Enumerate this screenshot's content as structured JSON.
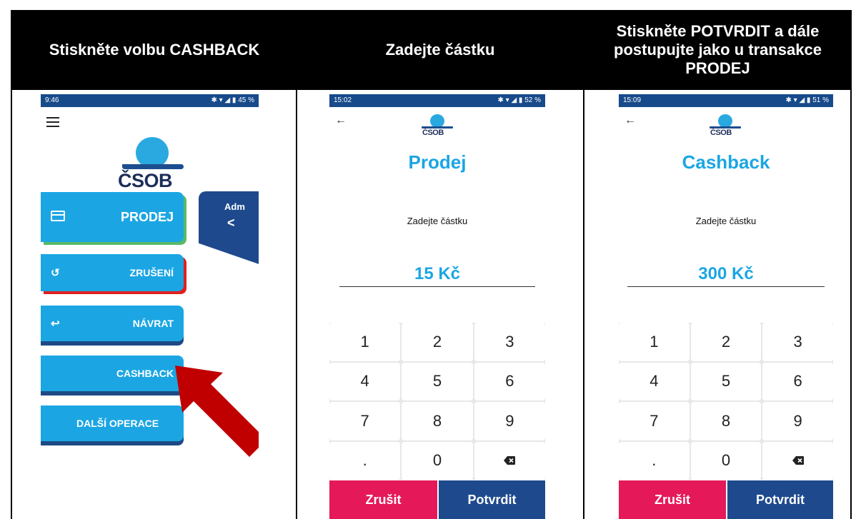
{
  "headers": {
    "col1": "Stiskněte volbu CASHBACK",
    "col2": "Zadejte částku",
    "col3": "Stiskněte POTVRDIT a dále postupujte jako u transakce PRODEJ"
  },
  "phone1": {
    "status_time": "9:46",
    "status_icons": "✱ ▾ ◢ ▮ 45 %",
    "logo_text": "ČSOB",
    "buttons": {
      "prodej": "PRODEJ",
      "zruseni": "ZRUŠENÍ",
      "navrat": "NÁVRAT",
      "cashback": "CASHBACK",
      "dalsi": "DALŠÍ OPERACE"
    },
    "admin_tab": "Adm",
    "admin_chevron": "<"
  },
  "phone2": {
    "status_time": "15:02",
    "status_icons": "✱ ▾ ◢ ▮ 52 %",
    "logo_text": "ČSOB",
    "back": "←",
    "title": "Prodej",
    "prompt": "Zadejte částku",
    "amount": "15 Kč",
    "keys": [
      "1",
      "2",
      "3",
      "4",
      "5",
      "6",
      "7",
      "8",
      "9",
      ".",
      "0"
    ],
    "cancel": "Zrušit",
    "confirm": "Potvrdit"
  },
  "phone3": {
    "status_time": "15:09",
    "status_icons": "✱ ▾ ◢ ▮ 51 %",
    "logo_text": "ČSOB",
    "back": "←",
    "title": "Cashback",
    "prompt": "Zadejte částku",
    "amount": "300 Kč",
    "keys": [
      "1",
      "2",
      "3",
      "4",
      "5",
      "6",
      "7",
      "8",
      "9",
      ".",
      "0"
    ],
    "cancel": "Zrušit",
    "confirm": "Potvrdit"
  },
  "colors": {
    "accent_blue": "#1ba6e3",
    "navy": "#1e4a8d",
    "cancel_pink": "#e5185a",
    "arrow_red": "#c00000"
  }
}
